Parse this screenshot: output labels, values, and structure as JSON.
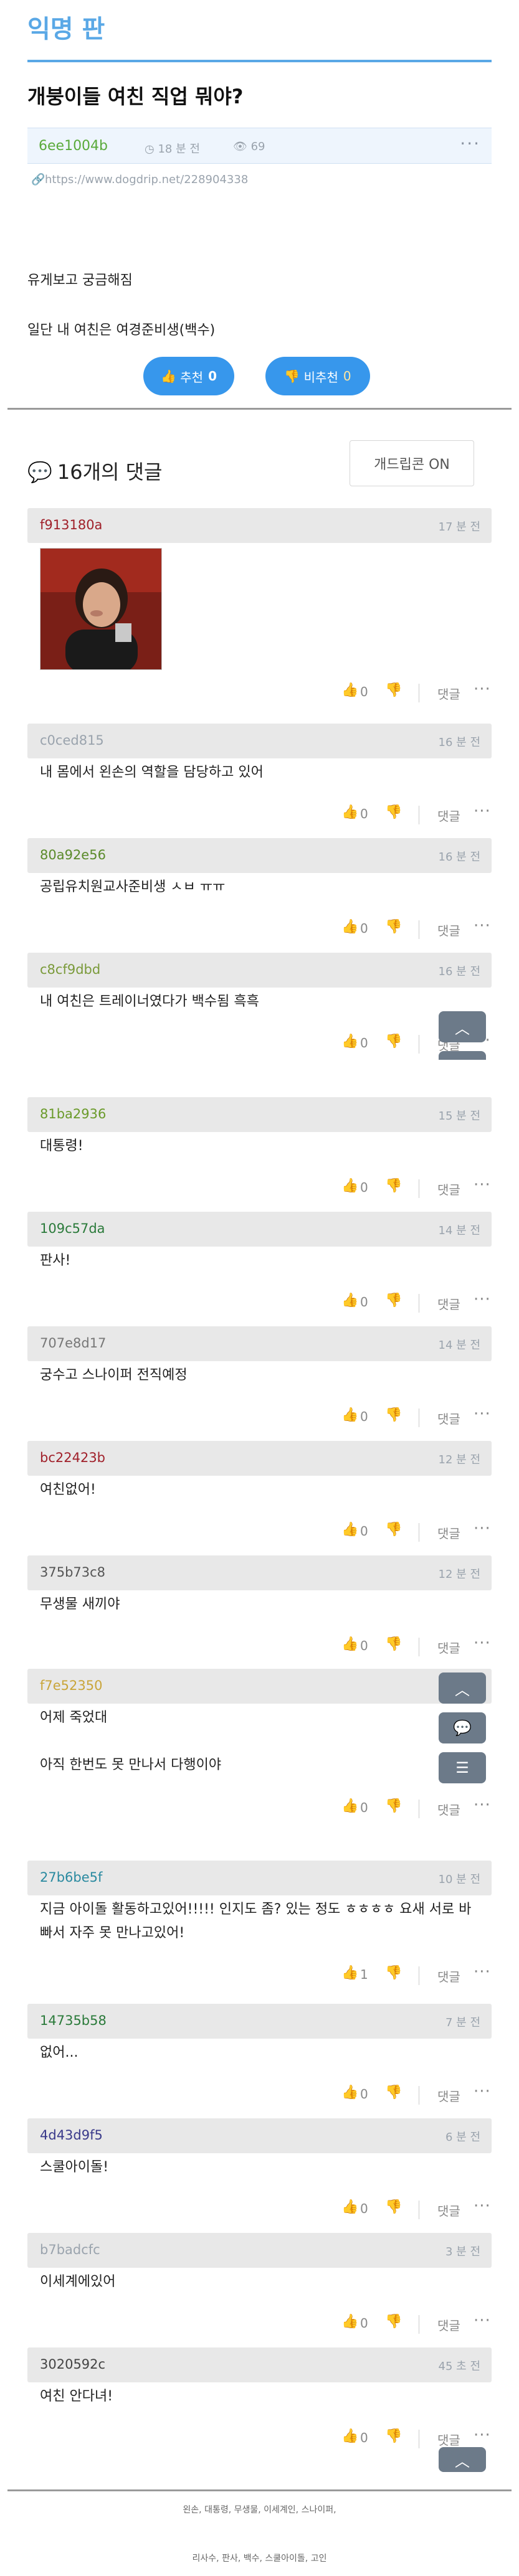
{
  "board": {
    "title": "익명 판"
  },
  "post": {
    "title": "개붕이들 여친 직업 뭐야?",
    "author": "6ee1004b",
    "time": "18 분 전",
    "views": "69",
    "more": "···",
    "link": "https://www.dogdrip.net/228904338",
    "body": [
      "유게보고 궁금해짐",
      "일단 내 여친은 여경준비생(백수)"
    ],
    "upvote_label": "추천",
    "upvote_count": "0",
    "downvote_label": "비추천",
    "downvote_count": "0"
  },
  "comments_section": {
    "title": "16개의 댓글",
    "dogdrip_button": "개드립콘 ON"
  },
  "comment_action_labels": {
    "reply": "댓글",
    "more": "···"
  },
  "comments": [
    {
      "author": "f913180a",
      "author_color": "#a0202a",
      "time": "17 분 전",
      "text": [],
      "has_image": true,
      "likes": "0"
    },
    {
      "author": "c0ced815",
      "author_color": "#9aa3ad",
      "time": "16 분 전",
      "text": [
        "내 몸에서 왼손의 역할을 담당하고 있어"
      ],
      "likes": "0"
    },
    {
      "author": "80a92e56",
      "author_color": "#5a8a2a",
      "time": "16 분 전",
      "text": [
        "공립유치원교사준비생 ㅅㅂ ㅠㅠ"
      ],
      "likes": "0"
    },
    {
      "author": "c8cf9dbd",
      "author_color": "#7a9a3a",
      "time": "16 분 전",
      "text": [
        "내 여친은 트레이너였다가 백수됨 흑흑"
      ],
      "likes": "0"
    },
    {
      "author": "81ba2936",
      "author_color": "#6a9a2a",
      "time": "15 분 전",
      "text": [
        "대통령!"
      ],
      "likes": "0"
    },
    {
      "author": "109c57da",
      "author_color": "#2a7a3a",
      "time": "14 분 전",
      "text": [
        "판사!"
      ],
      "likes": "0"
    },
    {
      "author": "707e8d17",
      "author_color": "#777777",
      "time": "14 분 전",
      "text": [
        "궁수고 스나이퍼 전직예정"
      ],
      "likes": "0"
    },
    {
      "author": "bc22423b",
      "author_color": "#a0202a",
      "time": "12 분 전",
      "text": [
        "여친없어!"
      ],
      "likes": "0"
    },
    {
      "author": "375b73c8",
      "author_color": "#555555",
      "time": "12 분 전",
      "text": [
        "무생물 새끼야"
      ],
      "likes": "0"
    },
    {
      "author": "f7e52350",
      "author_color": "#c9a53a",
      "time": "",
      "text": [
        "어제 죽었대",
        "아직 한번도 못 만나서 다행이야"
      ],
      "likes": "0"
    },
    {
      "author": "27b6be5f",
      "author_color": "#2a8aa0",
      "time": "10 분 전",
      "text": [
        "지금 아이돌 활동하고있어!!!!! 인지도 좀? 있는 정도 ㅎㅎㅎㅎ 요새 서로 바",
        "빠서 자주 못 만나고있어!"
      ],
      "likes": "1"
    },
    {
      "author": "14735b58",
      "author_color": "#2a7a3a",
      "time": "7 분 전",
      "text": [
        "없어..."
      ],
      "likes": "0"
    },
    {
      "author": "4d43d9f5",
      "author_color": "#3a3a8a",
      "time": "6 분 전",
      "text": [
        "스쿨아이돌!"
      ],
      "likes": "0"
    },
    {
      "author": "b7badcfc",
      "author_color": "#9aa3ad",
      "time": "3 분 전",
      "text": [
        "이세계에있어"
      ],
      "likes": "0"
    },
    {
      "author": "3020592c",
      "author_color": "#444444",
      "time": "45 초 전",
      "text": [
        "여친 안다녀!"
      ],
      "likes": "0"
    }
  ],
  "floating": {
    "up_icon": "chevron-up-icon",
    "chat_icon": "chat-bubble-icon",
    "list_icon": "list-icon"
  },
  "footer": {
    "line1": "왼손, 대통령, 무생물, 이세계인, 스나이퍼,",
    "line2": "리사수, 판사, 백수, 스쿨아이돌, 고인"
  },
  "colors": {
    "accent": "#3797ec",
    "board": "#5aa8e6",
    "floating": "#6c7a89"
  }
}
